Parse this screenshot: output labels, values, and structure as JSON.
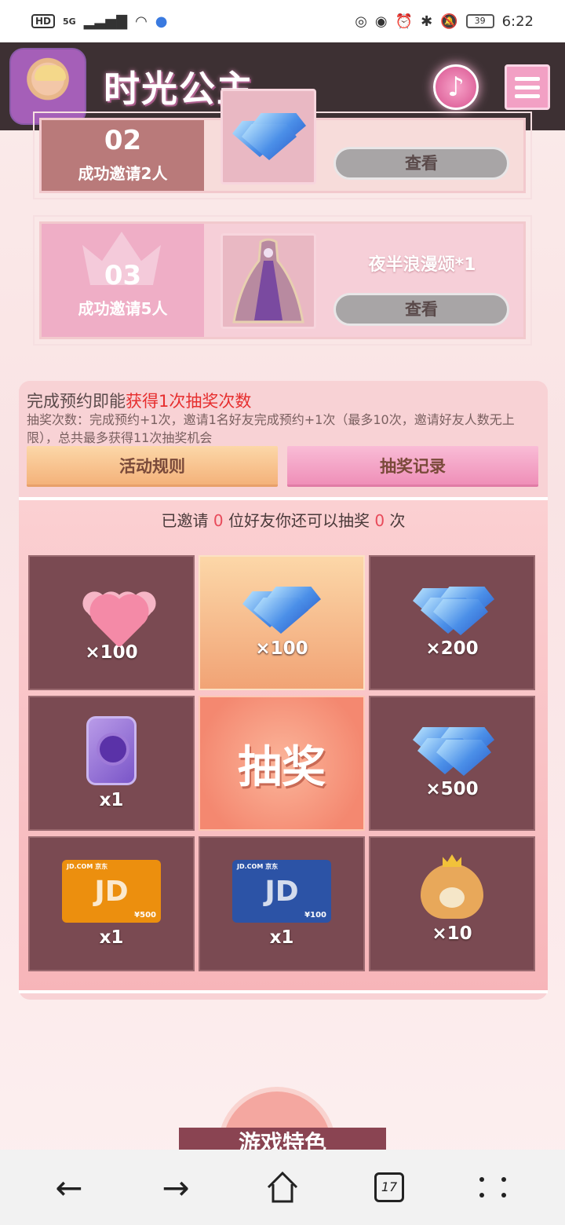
{
  "status_bar": {
    "left_badges": [
      "HD",
      "5G"
    ],
    "battery": "39",
    "time": "6:22"
  },
  "header": {
    "logo_text": "时光公主",
    "music_icon": "music-note-icon",
    "menu_icon": "hamburger-menu-icon"
  },
  "invites": [
    {
      "number": "02",
      "desc": "成功邀请2人",
      "prize_name": "",
      "prize_icon": "diamond-icon",
      "button": "查看"
    },
    {
      "number": "03",
      "desc": "成功邀请5人",
      "prize_name": "夜半浪漫颂*1",
      "prize_icon": "gown-icon",
      "button": "查看"
    }
  ],
  "lottery": {
    "title_prefix": "完成预约即能",
    "title_highlight": "获得1次抽奖次数",
    "description": "抽奖次数：完成预约+1次，邀请1名好友完成预约+1次（最多10次，邀请好友人数无上限），总共最多获得11次抽奖机会",
    "rules_button": "活动规则",
    "records_button": "抽奖记录",
    "invited_prefix": "已邀请",
    "invited_count": "0",
    "invited_middle": "位好友你还可以抽奖",
    "remaining_draws": "0",
    "invited_suffix": "次",
    "draw_button": "抽奖",
    "prizes": [
      {
        "icon": "hearts-icon",
        "qty": "×100"
      },
      {
        "icon": "diamond-icon",
        "qty": "×100"
      },
      {
        "icon": "diamond-pile-icon",
        "qty": "×200"
      },
      {
        "icon": "phone-icon",
        "qty": "x1"
      },
      {
        "icon": "diamond-pile-icon",
        "qty": "×500"
      },
      {
        "icon": "jd-card-500-icon",
        "qty": "x1",
        "card_amount": "¥500"
      },
      {
        "icon": "jd-card-100-icon",
        "qty": "x1",
        "card_amount": "¥100"
      },
      {
        "icon": "hamster-ticket-icon",
        "qty": "×10"
      }
    ]
  },
  "bottom": {
    "banner_text": "游戏特色"
  },
  "navbar": {
    "back": "←",
    "forward": "→",
    "tabs_count": "17"
  },
  "colors": {
    "header_bg": "#3d3033",
    "cell_bg": "#7a4a52",
    "highlight_red": "#e62e2e",
    "accent_pink": "#ef8fb8"
  }
}
